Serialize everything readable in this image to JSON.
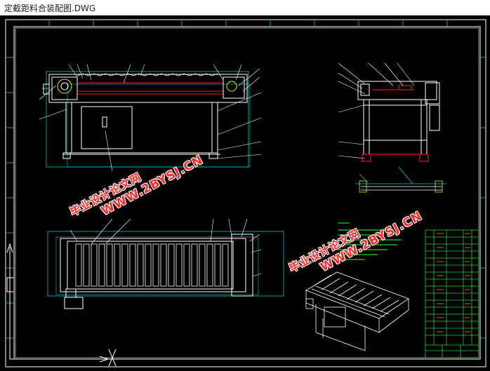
{
  "window": {
    "title": "定截距料合装配图.DWG"
  },
  "watermarks": [
    {
      "cn": "毕业设计论文网",
      "url": "WWW.2BYSJ.CN"
    },
    {
      "cn": "毕业设计论文网",
      "url": "WWW.2BYSJ.CN"
    }
  ],
  "colors": {
    "canvas": "#000000",
    "line": "#ffffff",
    "dim": "#00c8c8",
    "red": "#ff2020",
    "green": "#28d028",
    "yellow": "#e8e800"
  }
}
